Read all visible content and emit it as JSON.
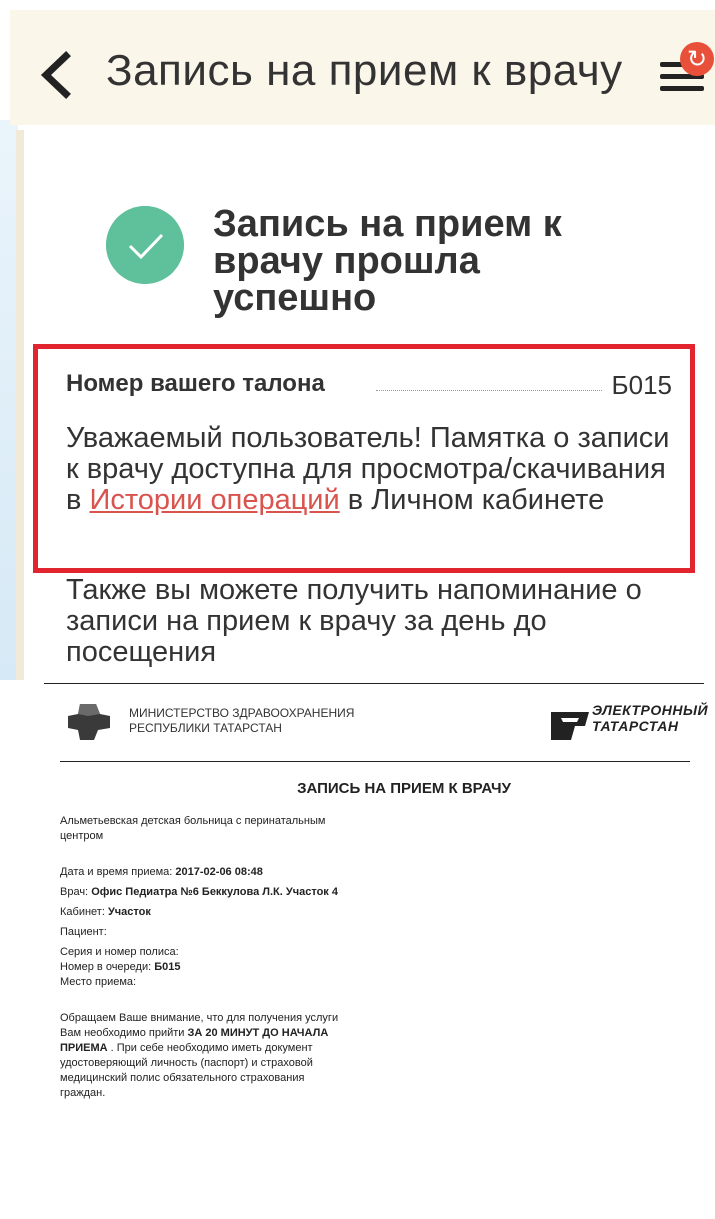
{
  "header": {
    "title": "Запись на прием к врачу",
    "badge": "↻"
  },
  "success": {
    "title": "Запись на прием к врачу прошла успешно"
  },
  "ticket": {
    "label": "Номер вашего талона",
    "value": "Б015"
  },
  "memo": {
    "text_before": "Уважаемый пользователь! Памятка о записи к врачу доступна для просмотра/скачивания в ",
    "link": "Истории операций",
    "text_after": " в Личном кабинете"
  },
  "reminder": {
    "text": "Также вы можете получить напоминание о записи на прием к врачу за день до посещения"
  },
  "document": {
    "ministry_line1": "МИНИСТЕРСТВО ЗДРАВООХРАНЕНИЯ",
    "ministry_line2": "РЕСПУБЛИКИ ТАТАРСТАН",
    "et_line1": "ЭЛЕКТРОННЫЙ",
    "et_line2": "ТАТАРСТАН",
    "title": "ЗАПИСЬ НА ПРИЕМ К ВРАЧУ",
    "hospital": "Альметьевская детская больница с перинатальным центром",
    "datetime_label": "Дата и время приема: ",
    "datetime_value": "2017-02-06 08:48",
    "doctor_label": "Врач: ",
    "doctor_value": "Офис Педиатра №6 Беккулова Л.К. Участок 4",
    "cabinet_label": "Кабинет: ",
    "cabinet_value": "Участок",
    "patient_label": "Пациент:",
    "policy_label": "Серия и номер полиса:",
    "queue_label": "Номер в очереди: ",
    "queue_value": "Б015",
    "place_label": "Место приема:",
    "notice_before": "Обращаем Ваше внимание, что для получения услуги Вам необходимо прийти ",
    "notice_bold": "ЗА 20 МИНУТ ДО НАЧАЛА ПРИЕМА",
    "notice_after": " . При себе необходимо иметь документ удостоверяющий личность (паспорт) и страховой медицинский полис обязательного страхования граждан."
  },
  "colors": {
    "accent_red": "#e2242f",
    "check_green": "#5fc09c",
    "link": "#d9534f",
    "badge": "#e8503a"
  }
}
